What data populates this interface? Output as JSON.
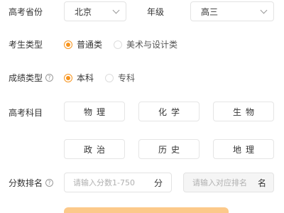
{
  "province": {
    "label": "高考省份",
    "value": "北京"
  },
  "grade": {
    "label": "年级",
    "value": "高三"
  },
  "student_type": {
    "label": "考生类型",
    "options": [
      "普通类",
      "美术与设计类"
    ],
    "selected": "普通类"
  },
  "score_type": {
    "label": "成绩类型",
    "options": [
      "本科",
      "专科"
    ],
    "selected": "本科"
  },
  "subjects": {
    "label": "高考科目",
    "items": [
      "物理",
      "化学",
      "生物",
      "政治",
      "历史",
      "地理"
    ]
  },
  "score_rank": {
    "label": "分数排名",
    "score_placeholder": "请输入分数1-750",
    "score_unit": "分",
    "rank_placeholder": "请输入对应排名",
    "rank_unit": "名"
  },
  "colors": {
    "accent": "#f7941d",
    "border": "#e3e3e3"
  },
  "icons": {
    "help": "question-circle-icon",
    "chevron": "chevron-down-icon"
  }
}
